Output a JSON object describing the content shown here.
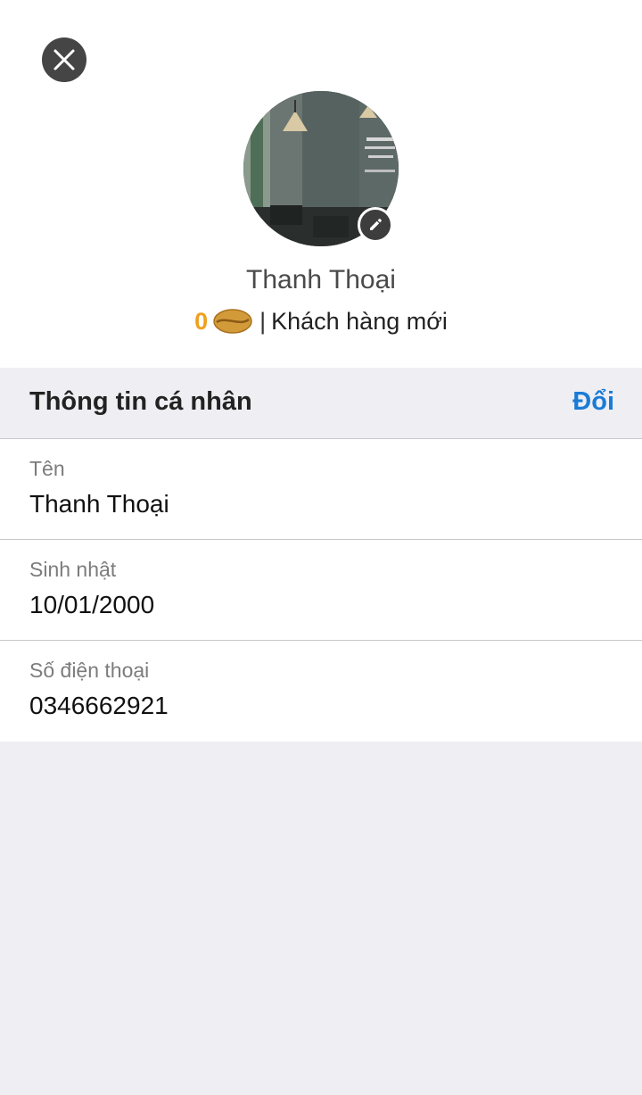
{
  "profile": {
    "name": "Thanh Thoại",
    "points": "0",
    "separator": "|",
    "tier": "Khách hàng mới"
  },
  "section": {
    "title": "Thông tin cá nhân",
    "action_label": "Đổi"
  },
  "fields": [
    {
      "label": "Tên",
      "value": "Thanh Thoại"
    },
    {
      "label": "Sinh nhật",
      "value": "10/01/2000"
    },
    {
      "label": "Số điện thoại",
      "value": "0346662921"
    }
  ],
  "icons": {
    "close": "close-icon",
    "edit": "pencil-icon",
    "points": "coffee-bean-icon"
  },
  "colors": {
    "accent": "#1a7bd6",
    "points": "#f0a020",
    "background": "#eeeef3"
  }
}
